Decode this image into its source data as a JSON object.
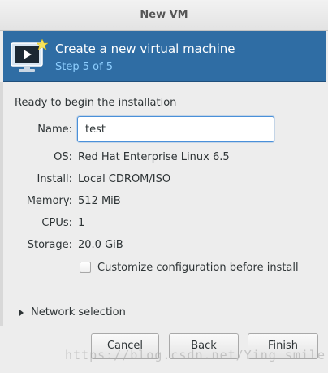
{
  "window": {
    "title": "New VM"
  },
  "banner": {
    "heading": "Create a new virtual machine",
    "step": "Step 5 of 5"
  },
  "summary": {
    "intro": "Ready to begin the installation",
    "name_label": "Name:",
    "name_value": "test",
    "rows": [
      {
        "label": "OS:",
        "value": "Red Hat Enterprise Linux 6.5"
      },
      {
        "label": "Install:",
        "value": "Local CDROM/ISO"
      },
      {
        "label": "Memory:",
        "value": "512 MiB"
      },
      {
        "label": "CPUs:",
        "value": "1"
      },
      {
        "label": "Storage:",
        "value": "20.0 GiB"
      }
    ],
    "customize_label": "Customize configuration before install",
    "customize_checked": false
  },
  "network": {
    "label": "Network selection",
    "expanded": false
  },
  "buttons": {
    "cancel": "Cancel",
    "back": "Back",
    "finish": "Finish"
  },
  "watermark": "https://blog.csdn.net/Ying_smile",
  "colors": {
    "banner": "#2f6da4",
    "step_text": "#8ecfff",
    "focus": "#4a90d9"
  }
}
